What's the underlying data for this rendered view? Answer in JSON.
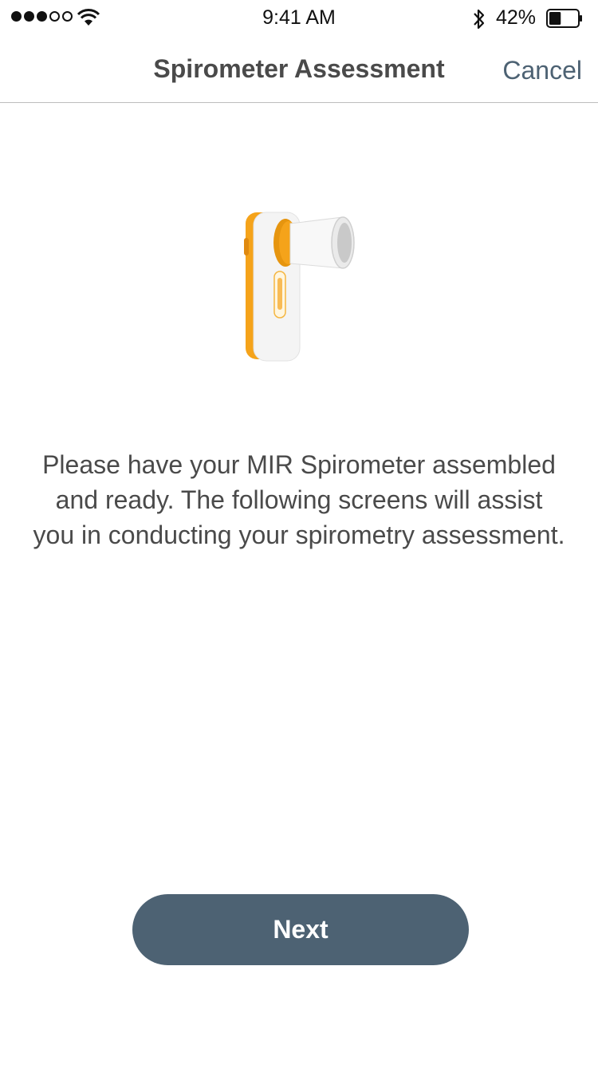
{
  "status_bar": {
    "signal_icon": "signal-strength-icon",
    "signal_bars_filled": 3,
    "signal_bars_total": 5,
    "wifi_icon": "wifi-icon",
    "time": "9:41 AM",
    "bluetooth_icon": "bluetooth-icon",
    "battery_percent": "42%",
    "battery_level": 0.42,
    "battery_icon": "battery-icon"
  },
  "nav": {
    "title": "Spirometer Assessment",
    "cancel_label": "Cancel"
  },
  "illustration": {
    "name": "spirometer-device",
    "accent_color": "#f5a31a"
  },
  "main": {
    "instructions": "Please have your MIR Spirometer assembled and ready. The following screens will assist you in conducting your spirometry assessment."
  },
  "footer": {
    "next_label": "Next"
  },
  "colors": {
    "primary": "#4d6273",
    "text": "#4a4a4a",
    "divider": "#bdbdbd"
  }
}
